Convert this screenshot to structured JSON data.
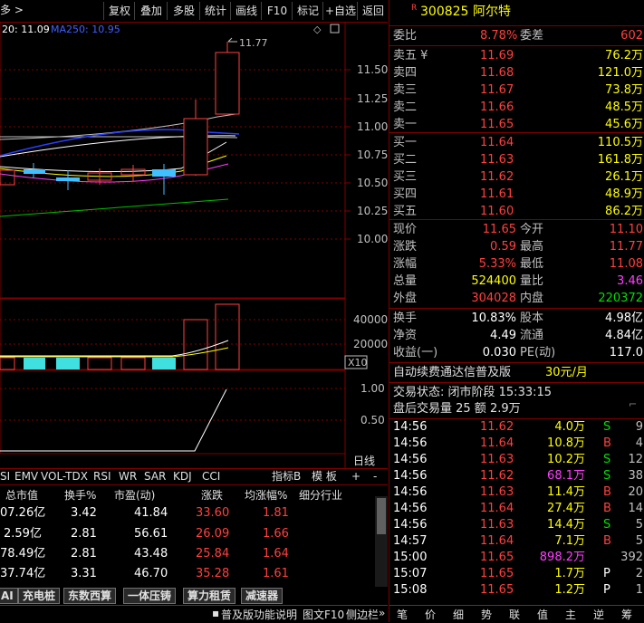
{
  "toolbar": {
    "crumb": "多 >",
    "buttons": [
      "复权",
      "叠加",
      "多股",
      "统计",
      "画线",
      "F10",
      "标记",
      "+自选",
      "返回"
    ]
  },
  "chart": {
    "ma_legend_a": "20: 11.09",
    "ma_legend_b": "MA250: 10.95",
    "price_ticks": [
      "11.50",
      "11.25",
      "11.00",
      "10.75",
      "10.50",
      "10.25",
      "10.00"
    ],
    "high_label": "11.77",
    "vol_ticks": [
      "40000",
      "20000"
    ],
    "vol_scale": "X10",
    "ind_ticks": [
      "1.00",
      "0.50"
    ],
    "period": "日线"
  },
  "quote": {
    "badge": "R",
    "code": "300825",
    "name": "阿尔特",
    "webi_label": "委比",
    "webi": "8.78%",
    "wecha_label": "委差",
    "wecha": "602",
    "asks": [
      {
        "label": "卖五 ¥",
        "price": "11.69",
        "vol": "76.2万"
      },
      {
        "label": "卖四",
        "price": "11.68",
        "vol": "121.0万"
      },
      {
        "label": "卖三",
        "price": "11.67",
        "vol": "73.8万"
      },
      {
        "label": "卖二",
        "price": "11.66",
        "vol": "48.5万"
      },
      {
        "label": "卖一",
        "price": "11.65",
        "vol": "45.6万"
      }
    ],
    "bids": [
      {
        "label": "买一",
        "price": "11.64",
        "vol": "110.5万"
      },
      {
        "label": "买二",
        "price": "11.63",
        "vol": "161.8万"
      },
      {
        "label": "买三",
        "price": "11.62",
        "vol": "26.1万"
      },
      {
        "label": "买四",
        "price": "11.61",
        "vol": "48.9万"
      },
      {
        "label": "买五",
        "price": "11.60",
        "vol": "86.2万"
      }
    ],
    "stats1": [
      {
        "l": "现价",
        "v": "11.65",
        "vc": "red",
        "l2": "今开",
        "v2": "11.10",
        "v2c": "red"
      },
      {
        "l": "涨跌",
        "v": "0.59",
        "vc": "red",
        "l2": "最高",
        "v2": "11.77",
        "v2c": "red"
      },
      {
        "l": "涨幅",
        "v": "5.33%",
        "vc": "red",
        "l2": "最低",
        "v2": "11.08",
        "v2c": "red"
      },
      {
        "l": "总量",
        "v": "524400",
        "vc": "yellow",
        "l2": "量比",
        "v2": "3.46",
        "v2c": "magenta"
      },
      {
        "l": "外盘",
        "v": "304028",
        "vc": "red",
        "l2": "内盘",
        "v2": "220372",
        "v2c": "green"
      }
    ],
    "stats2": [
      {
        "l": "换手",
        "v": "10.83%",
        "l2": "股本",
        "v2": "4.98亿"
      },
      {
        "l": "净资",
        "v": "4.49",
        "l2": "流通",
        "v2": "4.84亿"
      },
      {
        "l": "收益(一)",
        "v": "0.030",
        "l2": "PE(动)",
        "v2": "117.0"
      }
    ],
    "promo_a": "自动续费通达信普及版",
    "promo_b": "30元/月",
    "trade_status": "交易状态: 闭市阶段 15:33:15",
    "after_hours": "盘后交易量 25 额 2.9万"
  },
  "ticks": [
    {
      "t": "14:56",
      "p": "11.62",
      "v": "4.0万",
      "vc": "yellow",
      "bs": "S",
      "n": "9"
    },
    {
      "t": "14:56",
      "p": "11.64",
      "v": "10.8万",
      "vc": "yellow",
      "bs": "B",
      "n": "4"
    },
    {
      "t": "14:56",
      "p": "11.63",
      "v": "10.2万",
      "vc": "yellow",
      "bs": "S",
      "n": "12"
    },
    {
      "t": "14:56",
      "p": "11.62",
      "v": "68.1万",
      "vc": "magenta",
      "bs": "S",
      "n": "38"
    },
    {
      "t": "14:56",
      "p": "11.63",
      "v": "11.4万",
      "vc": "yellow",
      "bs": "B",
      "n": "20"
    },
    {
      "t": "14:56",
      "p": "11.64",
      "v": "27.4万",
      "vc": "yellow",
      "bs": "B",
      "n": "14"
    },
    {
      "t": "14:56",
      "p": "11.63",
      "v": "14.4万",
      "vc": "yellow",
      "bs": "S",
      "n": "5"
    },
    {
      "t": "14:57",
      "p": "11.64",
      "v": "7.1万",
      "vc": "yellow",
      "bs": "B",
      "n": "5"
    },
    {
      "t": "15:00",
      "p": "11.65",
      "v": "898.2万",
      "vc": "magenta",
      "bs": "",
      "n": "392"
    },
    {
      "t": "15:07",
      "p": "11.65",
      "v": "1.7万",
      "vc": "yellow",
      "bs": "P",
      "n": "2"
    },
    {
      "t": "15:08",
      "p": "11.65",
      "v": "1.2万",
      "vc": "yellow",
      "bs": "P",
      "n": "1"
    }
  ],
  "indicator_tabs": [
    "SI",
    "EMV",
    "VOL-TDX",
    "RSI",
    "WR",
    "SAR",
    "KDJ",
    "CCI",
    "指标B",
    "模 板",
    "+",
    "-"
  ],
  "table": {
    "headers": [
      "总市值",
      "换手%",
      "市盈(动)",
      "涨跌",
      "均涨幅%",
      "细分行业"
    ],
    "rows": [
      [
        "07.26亿",
        "3.42",
        "41.84",
        "33.60",
        "1.81"
      ],
      [
        "2.59亿",
        "2.81",
        "56.61",
        "26.09",
        "1.66"
      ],
      [
        "78.49亿",
        "2.81",
        "43.48",
        "25.84",
        "1.64"
      ],
      [
        "37.74亿",
        "3.31",
        "46.70",
        "35.28",
        "1.61"
      ]
    ]
  },
  "sector_tabs": [
    "AI",
    "充电桩",
    "东数西算",
    "一体压铸",
    "算力租赁",
    "减速器"
  ],
  "status": {
    "a": "普及版功能说明",
    "b": "图文F10",
    "c": "侧边栏"
  },
  "bottom_nav": [
    "笔",
    "价",
    "细",
    "势",
    "联",
    "值",
    "主",
    "逆",
    "筹"
  ]
}
